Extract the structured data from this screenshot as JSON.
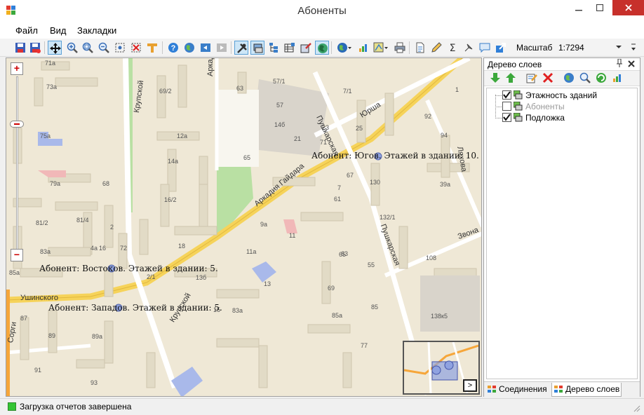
{
  "window": {
    "title": "Абоненты",
    "minimize_icon": "minimize-icon",
    "maximize_icon": "maximize-icon",
    "close_icon": "close-icon",
    "close_color": "#c7302b"
  },
  "menu": {
    "items": [
      {
        "label": "Файл"
      },
      {
        "label": "Вид"
      },
      {
        "label": "Закладки"
      }
    ]
  },
  "toolbar": {
    "buttons": [
      {
        "icon": "save-icon"
      },
      {
        "icon": "save-as-icon"
      },
      {
        "icon": "pan-icon",
        "active": true
      },
      {
        "icon": "zoom-in-icon"
      },
      {
        "icon": "zoom-window-icon"
      },
      {
        "icon": "zoom-out-icon"
      },
      {
        "icon": "select-icon"
      },
      {
        "icon": "clear-selection-icon"
      },
      {
        "icon": "measure-icon"
      },
      {
        "icon": "help-icon"
      },
      {
        "icon": "globe-icon"
      },
      {
        "icon": "back-icon"
      },
      {
        "icon": "forward-icon"
      },
      {
        "icon": "tools-icon",
        "active": true
      },
      {
        "icon": "layer-icon",
        "active": true
      },
      {
        "icon": "tree-icon"
      },
      {
        "icon": "table-icon"
      },
      {
        "icon": "edit-icon"
      },
      {
        "icon": "earth-icon",
        "active": true
      },
      {
        "icon": "earth-dropdown-icon"
      },
      {
        "icon": "chart-icon"
      },
      {
        "icon": "map-dropdown-icon"
      },
      {
        "icon": "print-icon"
      },
      {
        "icon": "document-icon"
      },
      {
        "icon": "pen-icon"
      },
      {
        "icon": "sigma-icon"
      },
      {
        "icon": "pin-icon"
      },
      {
        "icon": "comment-icon"
      },
      {
        "icon": "share-icon"
      }
    ],
    "scale_label": "Масштаб",
    "scale_value": "1:7294"
  },
  "map": {
    "streets": {
      "arkadiya_gaidara": "Аркадия Гайдара",
      "arkadiya_gaidara_top": "Аркадия Гайдара",
      "yursha": "Юрша",
      "pushkarskaya_top": "Пушкарская",
      "pushkarskaya_bottom": "Пушкарская",
      "krupskoy_top": "Крупской",
      "krupskoy_bottom": "Крупской",
      "ushinskogo": "Ушинского",
      "lyakhova": "Ляхова",
      "zvonareva": "Звона",
      "sorgina": "Сорги"
    },
    "house_numbers": [
      "71а",
      "73а",
      "69/2",
      "12а",
      "75а",
      "79а",
      "68",
      "14а",
      "16/2",
      "81/2",
      "81/4",
      "2",
      "16",
      "83а",
      "4а",
      "72",
      "18",
      "85а",
      "2/1",
      "13б",
      "15",
      "83а",
      "87",
      "89а",
      "89",
      "91",
      "93",
      "57/1",
      "57",
      "63",
      "65",
      "14б",
      "71",
      "7/1",
      "67",
      "61",
      "9а",
      "11",
      "11а",
      "13",
      "63",
      "65",
      "69",
      "85",
      "85а",
      "77",
      "130",
      "132/1",
      "39а",
      "92",
      "94",
      "108",
      "138к5",
      "7",
      "21",
      "23",
      "25",
      "55",
      "1"
    ],
    "subscribers": [
      {
        "label": "Абонент: Югов. Этажей в здании: 10."
      },
      {
        "label": "Абонент: Востоков. Этажей в здании: 5."
      },
      {
        "label": "Абонент: Западов. Этажей в здании: 5."
      }
    ],
    "zoom_in_label": "+",
    "zoom_out_label": "−",
    "minimap_toggle_label": ">",
    "colors": {
      "background": "#efe8d6",
      "building": "#e2dbc6",
      "main_road": "#f6d35a",
      "park": "#b9e0a3",
      "subscriber_marker": "#8fa2e0"
    }
  },
  "panel": {
    "title": "Дерево слоев",
    "pin_icon": "pin-icon",
    "close_icon": "close-icon",
    "tools": [
      "move-down-icon",
      "move-up-icon",
      "edit-layer-icon",
      "delete-layer-icon",
      "globe-icon",
      "search-icon",
      "refresh-icon",
      "chart-icon"
    ],
    "layers": [
      {
        "label": "Этажность зданий",
        "checked": true,
        "disabled": false
      },
      {
        "label": "Абоненты",
        "checked": false,
        "disabled": true
      },
      {
        "label": "Подложка",
        "checked": true,
        "disabled": false
      }
    ],
    "tabs": [
      {
        "label": "Соединения",
        "active": false
      },
      {
        "label": "Дерево слоев",
        "active": true
      }
    ]
  },
  "status": {
    "text": "Загрузка отчетов завершена",
    "light_color": "#35c535"
  }
}
